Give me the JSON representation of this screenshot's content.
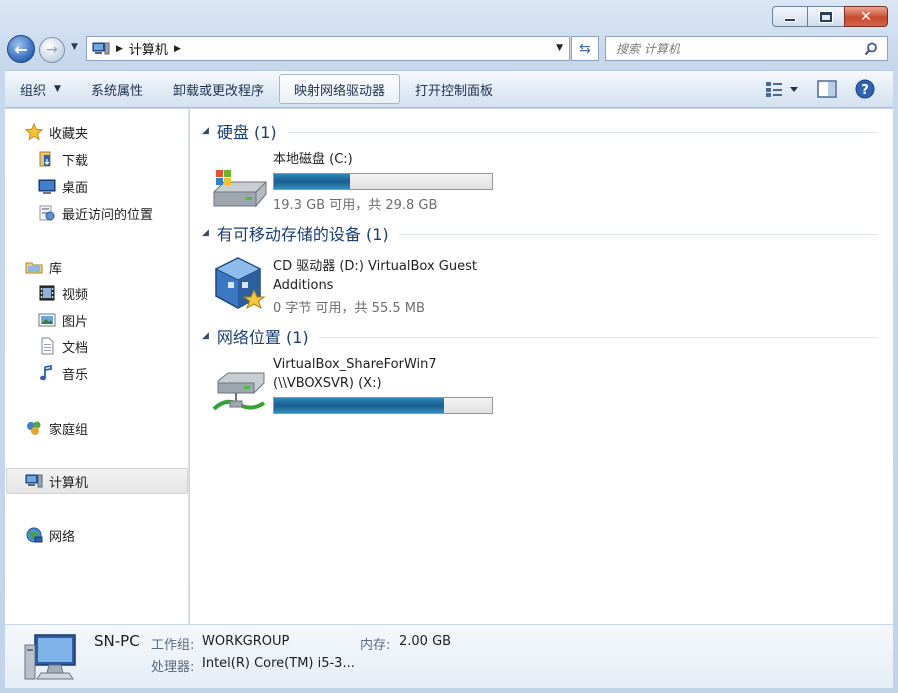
{
  "window": {
    "minimize_glyph": "",
    "maximize_glyph": "",
    "close_glyph": "✕"
  },
  "address": {
    "crumbs": [
      "计算机"
    ],
    "search_placeholder": "搜索 计算机"
  },
  "toolbar": {
    "organize": "组织",
    "system_properties": "系统属性",
    "uninstall": "卸载或更改程序",
    "map_drive": "映射网络驱动器",
    "control_panel": "打开控制面板",
    "view_icon": "view-options-icon",
    "preview_icon": "preview-pane-icon",
    "help_icon": "help-icon"
  },
  "sidebar": {
    "favorites": {
      "label": "收藏夹",
      "items": [
        {
          "label": "下载"
        },
        {
          "label": "桌面"
        },
        {
          "label": "最近访问的位置"
        }
      ]
    },
    "libraries": {
      "label": "库",
      "items": [
        {
          "label": "视频"
        },
        {
          "label": "图片"
        },
        {
          "label": "文档"
        },
        {
          "label": "音乐"
        }
      ]
    },
    "homegroup": "家庭组",
    "computer": "计算机",
    "network": "网络"
  },
  "groups": [
    {
      "title": "硬盘 (1)",
      "drives": [
        {
          "name": "本地磁盘 (C:)",
          "used_fraction": 0.35,
          "size_text": "19.3 GB 可用，共 29.8 GB"
        }
      ]
    },
    {
      "title": "有可移动存储的设备 (1)",
      "drives": [
        {
          "name_line1": "CD 驱动器 (D:) VirtualBox Guest",
          "name_line2": "Additions",
          "size_text": "0 字节 可用，共 55.5 MB"
        }
      ]
    },
    {
      "title": "网络位置 (1)",
      "drives": [
        {
          "name_line1": "VirtualBox_ShareForWin7",
          "name_line2": "(\\\\VBOXSVR) (X:)",
          "used_fraction": 0.78
        }
      ]
    }
  ],
  "details": {
    "pc_name": "SN-PC",
    "workgroup_label": "工作组:",
    "workgroup_value": "WORKGROUP",
    "memory_label": "内存:",
    "memory_value": "2.00 GB",
    "cpu_label": "处理器:",
    "cpu_value": "Intel(R) Core(TM) i5-3..."
  }
}
